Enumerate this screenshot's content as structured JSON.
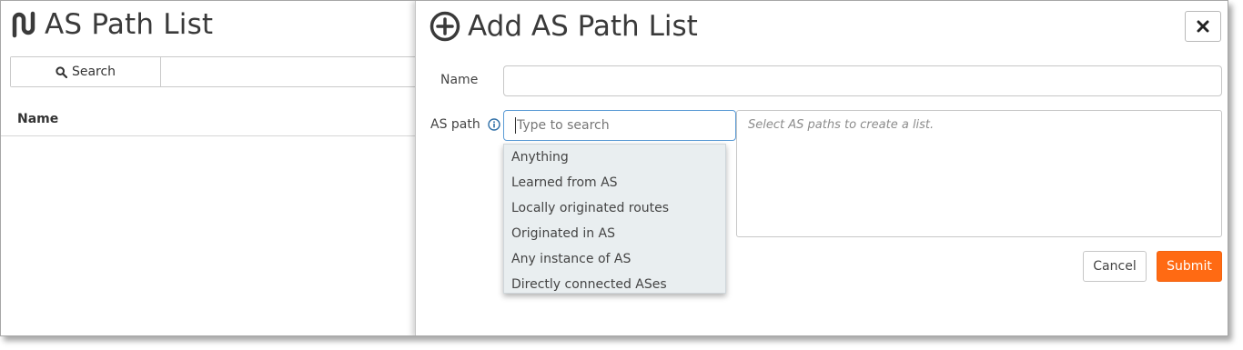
{
  "page": {
    "title": "AS Path List",
    "logo_icon": "app-logo-icon",
    "search": {
      "label": "Search",
      "icon": "search-icon",
      "value": ""
    },
    "table": {
      "columns": [
        "Name"
      ]
    }
  },
  "modal": {
    "title": "Add AS Path List",
    "title_icon": "plus-circle-icon",
    "close_icon": "close-icon",
    "name_field": {
      "label": "Name",
      "value": ""
    },
    "aspath_field": {
      "label": "AS path",
      "info_icon": "info-icon",
      "placeholder": "Type to search",
      "value": ""
    },
    "selected_placeholder": "Select AS paths to create a list.",
    "dropdown_options": [
      "Anything",
      "Learned from AS",
      "Locally originated routes",
      "Originated in AS",
      "Any instance of AS",
      "Directly connected ASes"
    ],
    "cancel_label": "Cancel",
    "submit_label": "Submit"
  },
  "colors": {
    "accent": "#ff6a13",
    "focus_border": "#5b9bd5",
    "dropdown_bg": "#e9eef0",
    "info_icon": "#2f6fa7"
  }
}
